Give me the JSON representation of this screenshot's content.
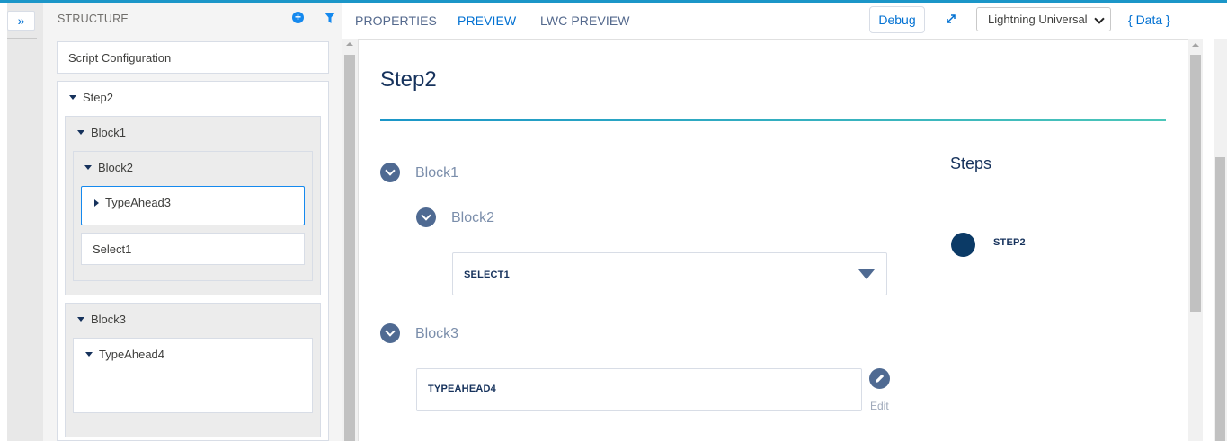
{
  "rail": {
    "expand_glyph": "»"
  },
  "structure": {
    "title": "STRUCTURE",
    "add_icon": "plus-circle-icon",
    "filter_icon": "filter-icon",
    "script_configuration": "Script Configuration",
    "step": "Step2",
    "block1": "Block1",
    "block2": "Block2",
    "typeahead3": "TypeAhead3",
    "select1": "Select1",
    "block3": "Block3",
    "typeahead4": "TypeAhead4"
  },
  "tabs": {
    "properties": "PROPERTIES",
    "preview": "PREVIEW",
    "lwc_preview": "LWC PREVIEW",
    "active": "preview"
  },
  "toolbar": {
    "debug": "Debug",
    "expand_icon": "expand-arrows-icon",
    "layout_select": "Lightning Universal",
    "data_link": "{ Data }"
  },
  "preview": {
    "step_title": "Step2",
    "block1": "Block1",
    "block2": "Block2",
    "select1_label": "SELECT1",
    "block3": "Block3",
    "typeahead4_label": "TYPEAHEAD4",
    "edit_label": "Edit",
    "steps_heading": "Steps",
    "steps": [
      {
        "name": "STEP2",
        "state": "current"
      }
    ]
  },
  "colors": {
    "accent": "#0070d2",
    "heading": "#16325c",
    "chevron": "#4f6a92",
    "rule_start": "#1b96c8",
    "rule_end": "#4bc6b9",
    "step_dot": "#0b3a66"
  }
}
